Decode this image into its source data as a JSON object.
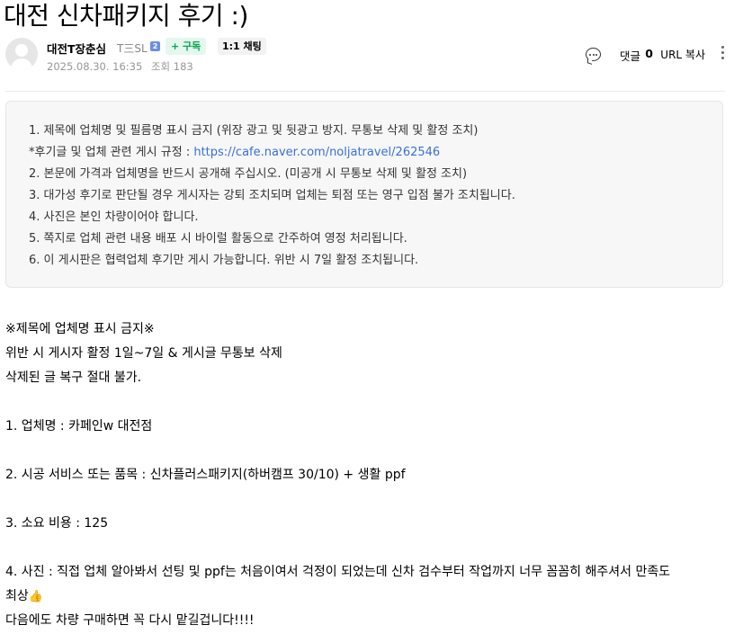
{
  "post": {
    "title": "대전 신차패키지 후기 :)"
  },
  "author": {
    "name": "대전T장춘심",
    "grade": "T三SL",
    "grade_badge": "2",
    "subscribe_label": "+ 구독",
    "chat_label": "1:1 채팅",
    "date": "2025.08.30. 16:35",
    "views": "조회 183"
  },
  "tools": {
    "comment_label": "댓글",
    "comment_count": "0",
    "url_copy_label": "URL 복사"
  },
  "notice": {
    "line1": "1. 제목에 업체명 및 필름명 표시 금지 (위장 광고 및 뒷광고 방지. 무통보 삭제 및 활정 조치)",
    "line2_prefix": "*후기글 및 업체 관련 게시 규정 : ",
    "line2_link": "https://cafe.naver.com/noljatravel/262546",
    "line3": "2. 본문에 가격과 업체명을 반드시 공개해 주십시오. (미공개 시 무통보 삭제 및 활정 조치)",
    "line4": "3. 대가성 후기로 판단될 경우 게시자는 강퇴 조치되며 업체는 퇴점 또는 영구 입점 불가 조치됩니다.",
    "line5": "4. 사진은 본인 차량이어야 합니다.",
    "line6": "5. 쪽지로 업체 관련 내용 배포 시 바이럴 활동으로 간주하여 영정 처리됩니다.",
    "line7": "6. 이 게시판은 협력업체 후기만 게시 가능합니다. 위반 시 7일 활정 조치됩니다."
  },
  "body": {
    "warn1": "※제목에 업체명 표시 금지※",
    "warn2": "위반 시 게시자 활정 1일~7일 & 게시글 무통보 삭제",
    "warn3": "삭제된 글 복구 절대 불가.",
    "item1": "1. 업체명 :  카페인w 대전점",
    "item2": "2. 시공 서비스 또는 품목 :  신차플러스패키지(하버캠프 30/10) + 생활 ppf",
    "item3": "3. 소요 비용 :  125",
    "item4a": "4. 사진 :  직접 업체 알아봐서 선팅 및 ppf는 처음이여서 걱정이 되었는데 신차 검수부터 작업까지 너무 꼼꼼히 해주셔서 만족도",
    "item4b": "최상",
    "thumb_emoji": "👍",
    "closing": "다음에도 차량 구매하면 꼭 다시 맡길겁니다!!!!"
  }
}
